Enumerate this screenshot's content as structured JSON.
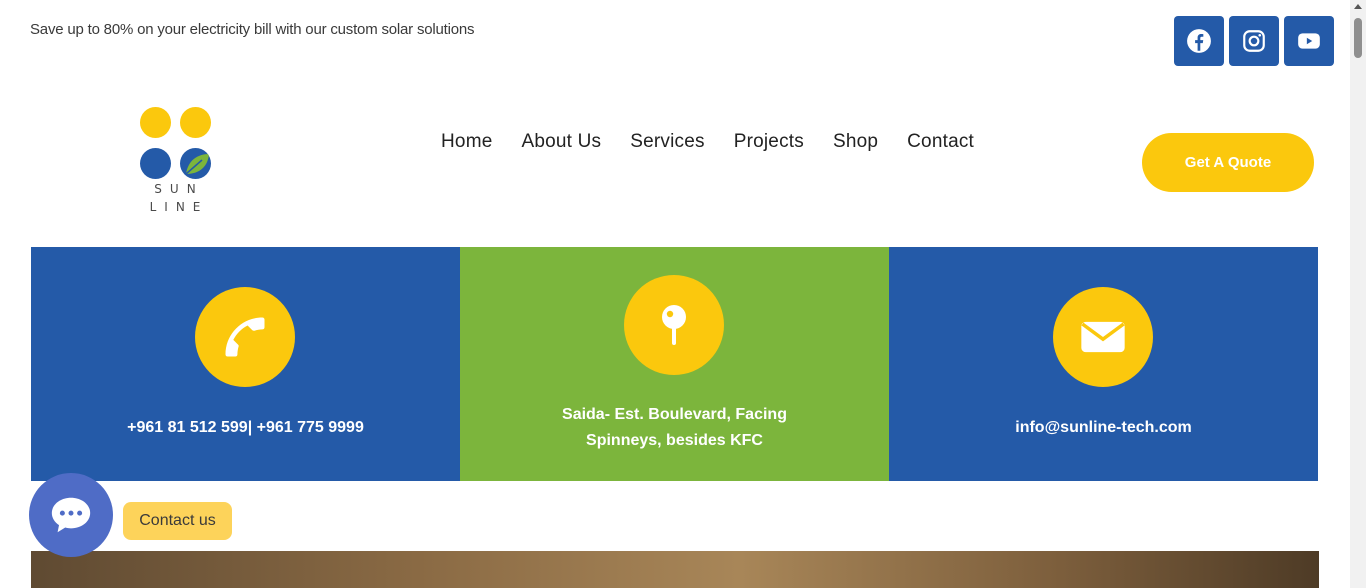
{
  "topbar": {
    "promo_text": "Save up to 80% on your electricity bill with our custom solar solutions",
    "social": [
      "facebook-icon",
      "instagram-icon",
      "youtube-icon"
    ],
    "social_color": "#245aa8"
  },
  "header": {
    "logo": {
      "line1": "SUN",
      "line2": "LINE"
    },
    "nav": [
      "Home",
      "About Us",
      "Services",
      "Projects",
      "Shop",
      "Contact"
    ],
    "cta_label": "Get A Quote",
    "cta_color": "#fbc80d"
  },
  "contact_panels": [
    {
      "icon": "phone-icon",
      "text": "+961 81 512 599| +961 775 9999",
      "bg": "#245aa8"
    },
    {
      "icon": "map-pin-icon",
      "text_line1": "Saida- Est. Boulevard, Facing",
      "text_line2": "Spinneys, besides KFC",
      "bg": "#7cb53c"
    },
    {
      "icon": "envelope-icon",
      "text": "info@sunline-tech.com",
      "bg": "#245aa8"
    }
  ],
  "chat_widget": {
    "label": "Contact us",
    "icon": "chat-icon"
  }
}
